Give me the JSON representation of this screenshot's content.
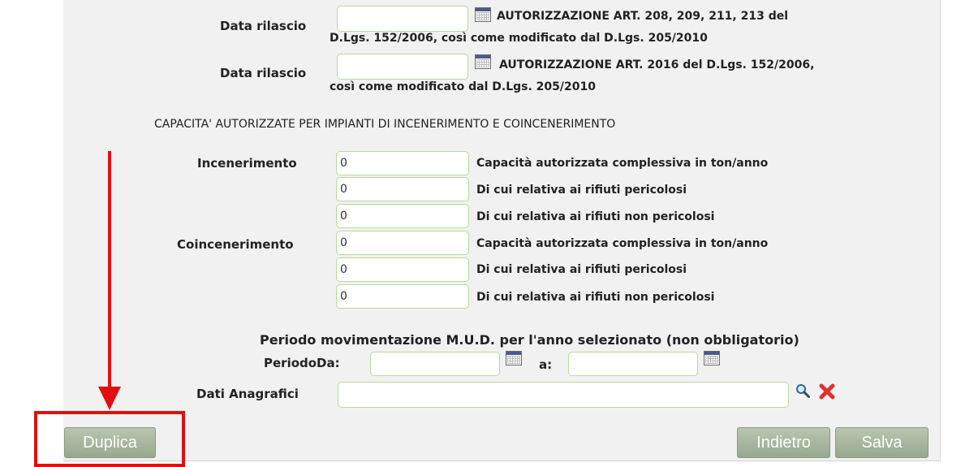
{
  "authorizations": [
    {
      "label": "Data rilascio",
      "value": "",
      "description_line1": "AUTORIZZAZIONE ART. 208, 209, 211, 213 del",
      "description_line2": "D.Lgs. 152/2006, così come modificato dal D.Lgs. 205/2010"
    },
    {
      "label": "Data rilascio",
      "value": "",
      "description_line1": "AUTORIZZAZIONE ART. 2016 del D.Lgs. 152/2006,",
      "description_line2": "così come modificato dal D.Lgs. 205/2010"
    }
  ],
  "capacity": {
    "heading": "CAPACITA' AUTORIZZATE PER IMPIANTI DI INCENERIMENTO E COINCENERIMENTO",
    "groups": [
      {
        "label": "Incenerimento",
        "rows": [
          {
            "value": "0",
            "description": "Capacità autorizzata complessiva in ton/anno"
          },
          {
            "value": "0",
            "description": "Di cui relativa ai rifiuti pericolosi"
          },
          {
            "value": "0",
            "description": "Di cui relativa ai rifiuti non pericolosi"
          }
        ]
      },
      {
        "label": "Coincenerimento",
        "rows": [
          {
            "value": "0",
            "description": "Capacità autorizzata complessiva in ton/anno"
          },
          {
            "value": "0",
            "description": "Di cui relativa ai rifiuti pericolosi"
          },
          {
            "value": "0",
            "description": "Di cui relativa ai rifiuti non pericolosi"
          }
        ]
      }
    ]
  },
  "period": {
    "heading": "Periodo movimentazione M.U.D. per l'anno selezionato (non obbligatorio)",
    "label_from": "PeriodoDa:",
    "from_value": "",
    "label_to": "a:",
    "to_value": ""
  },
  "anagrafica": {
    "label": "Dati Anagrafici",
    "value": "",
    "search_icon": "magnifier-icon",
    "clear_icon": "red-x-icon"
  },
  "buttons": {
    "duplica": "Duplica",
    "indietro": "Indietro",
    "salva": "Salva"
  },
  "colors": {
    "annotation_red": "#e01010",
    "field_border": "#b9d99a",
    "button_bg": "#a8b6a0"
  }
}
